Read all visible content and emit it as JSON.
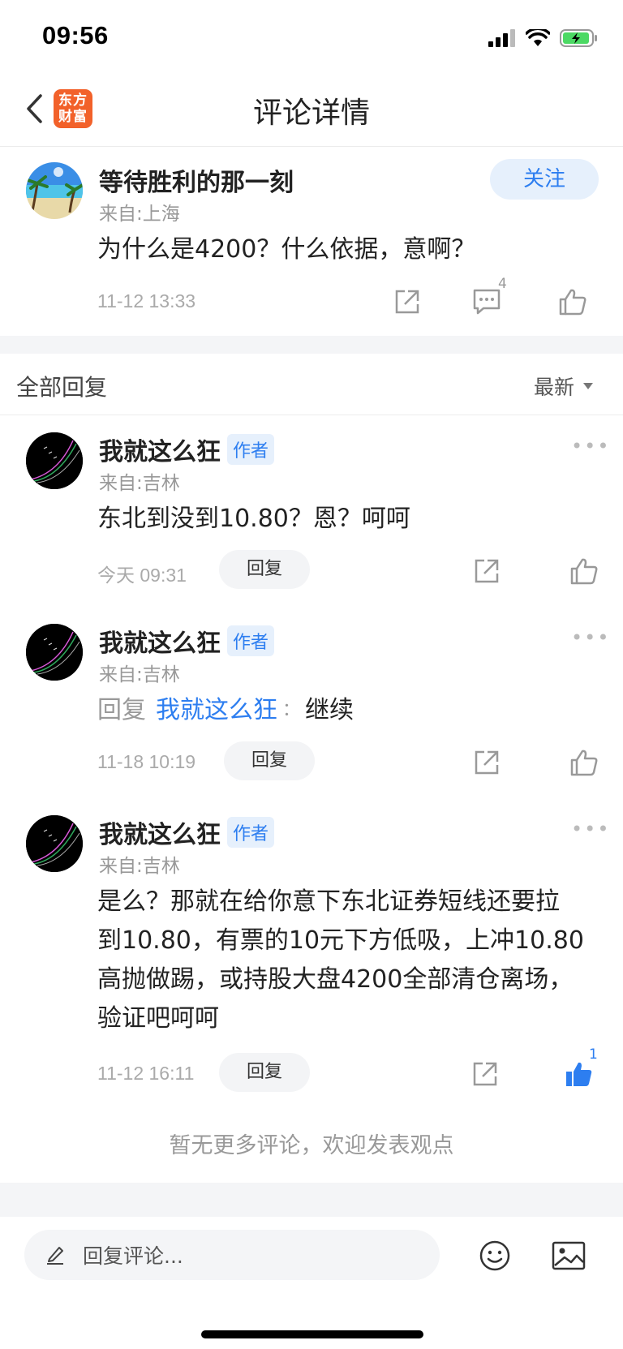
{
  "status_bar": {
    "time": "09:56"
  },
  "nav": {
    "title": "评论详情",
    "logo_line1": "东方",
    "logo_line2": "财富"
  },
  "post": {
    "user_name": "等待胜利的那一刻",
    "from": "来自:上海",
    "follow_label": "关注",
    "content": "为什么是4200？什么依据，意啊？",
    "time": "11-12 13:33",
    "comment_count": "4"
  },
  "replies_header": {
    "title": "全部回复",
    "sort_label": "最新"
  },
  "replies": [
    {
      "user_name": "我就这么狂",
      "badge": "作者",
      "from": "来自:吉林",
      "content": "东北到没到10.80？恩？呵呵",
      "time": "今天 09:31",
      "reply_label": "回复"
    },
    {
      "user_name": "我就这么狂",
      "badge": "作者",
      "from": "来自:吉林",
      "reply_prefix": "回复",
      "reply_to": "我就这么狂",
      "colon": "：",
      "content": "继续",
      "time": "11-18 10:19",
      "reply_label": "回复"
    },
    {
      "user_name": "我就这么狂",
      "badge": "作者",
      "from": "来自:吉林",
      "content_lines": [
        "是么？那就在给你意下东北证券短线还要拉",
        "到10.80，有票的10元下方低吸，上冲10.80",
        "高抛做踢，或持股大盘4200全部清仓离场，",
        "验证吧呵呵"
      ],
      "time": "11-12 16:11",
      "reply_label": "回复",
      "like_count": "1"
    }
  ],
  "footer_text": "暂无更多评论，欢迎发表观点",
  "bottom_bar": {
    "input_placeholder": "回复评论..."
  },
  "colors": {
    "accent_blue": "#2d7ef0",
    "brand_orange": "#f2612a",
    "muted_gray": "#999999"
  },
  "icons": [
    "back-arrow-icon",
    "share-icon",
    "comment-icon",
    "thumbs-up-icon",
    "more-dots-icon",
    "dropdown-arrow-icon",
    "pencil-icon",
    "emoji-icon",
    "image-icon",
    "signal-icon",
    "wifi-icon",
    "battery-icon"
  ]
}
